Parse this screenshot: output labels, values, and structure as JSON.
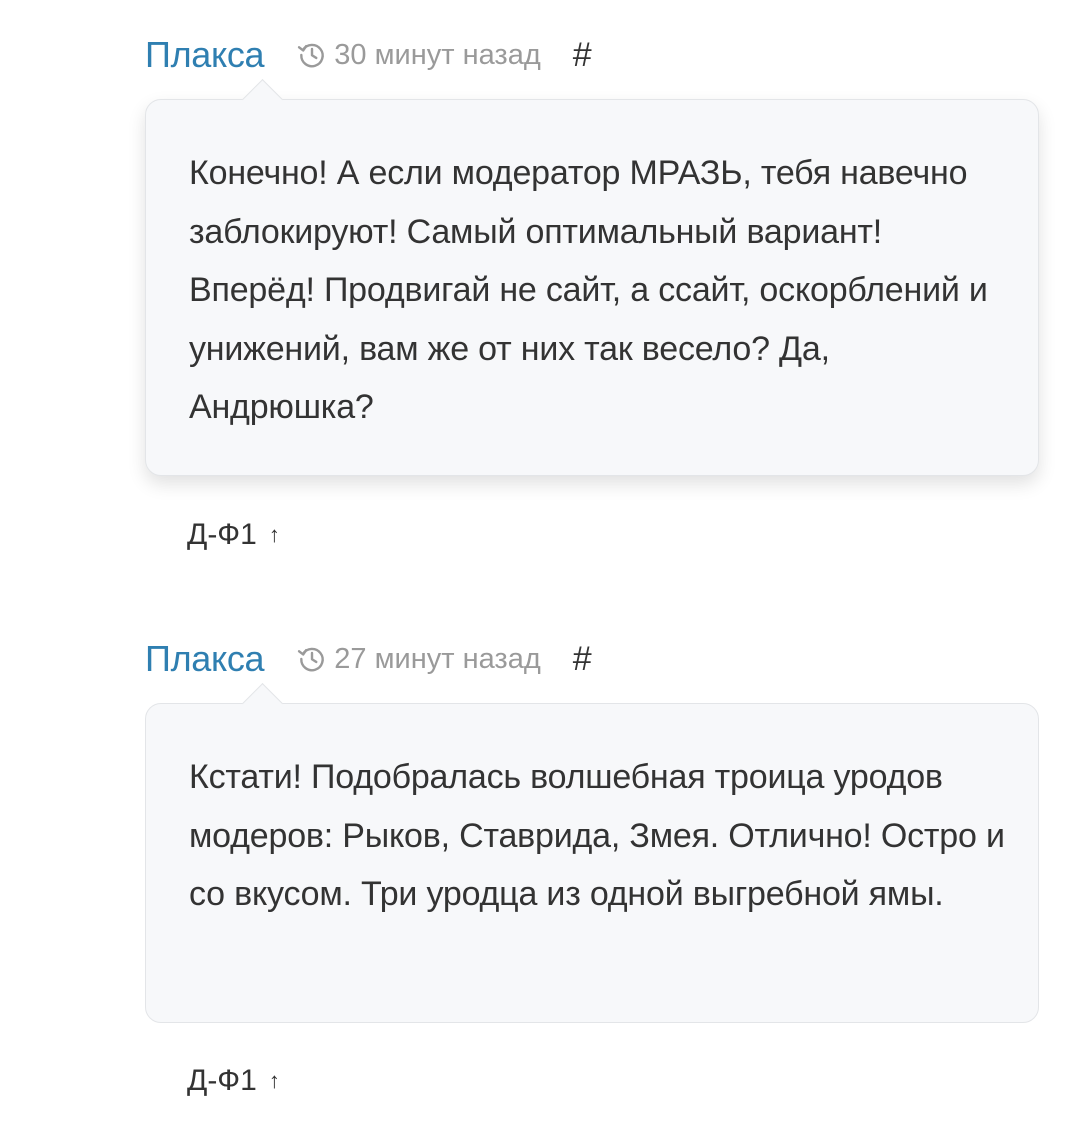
{
  "comments": [
    {
      "author": "Плакса",
      "time": "30 минут назад",
      "permalink": "#",
      "text": "Конечно! А если модератор МРАЗЬ, тебя навечно заблокируют! Самый оптимальный вариант! Вперёд! Продвигай не сайт, а ссайт, оскорблений и унижений, вам же от них так весело? Да, Андрюшка?",
      "parent": "Д-Ф1",
      "parent_arrow": "↑",
      "time_icon": "history-icon"
    },
    {
      "author": "Плакса",
      "time": "27 минут назад",
      "permalink": "#",
      "text": "Кстати! Подобралась волшебная троица уродов модеров: Рыков, Ставрида, Змея. Отлично! Остро и со вкусом. Три уродца из одной выгребной ямы.",
      "parent": "Д-Ф1",
      "parent_arrow": "↑",
      "time_icon": "history-icon"
    }
  ],
  "colors": {
    "author": "#2f7fb1",
    "meta": "#9a9a9a",
    "bubble_bg": "#f7f8fa",
    "text": "#333333"
  }
}
